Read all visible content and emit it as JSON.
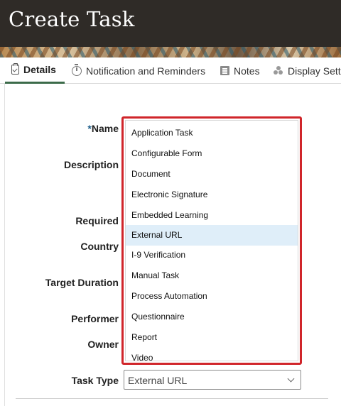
{
  "header": {
    "title": "Create Task"
  },
  "tabs": [
    {
      "label": "Details",
      "icon": "clipboard-check-icon"
    },
    {
      "label": "Notification and Reminders",
      "icon": "timer-icon"
    },
    {
      "label": "Notes",
      "icon": "note-icon"
    },
    {
      "label": "Display Sett",
      "icon": "display-settings-icon"
    }
  ],
  "form": {
    "required_marker": "*",
    "labels": {
      "name": "Name",
      "description": "Description",
      "required": "Required",
      "country": "Country",
      "target_duration": "Target Duration",
      "performer": "Performer",
      "owner": "Owner",
      "task_type": "Task Type"
    },
    "task_type_value": "External URL"
  },
  "dropdown": {
    "options": [
      "Application Task",
      "Configurable Form",
      "Document",
      "Electronic Signature",
      "Embedded Learning",
      "External URL",
      "I-9 Verification",
      "Manual Task",
      "Process Automation",
      "Questionnaire",
      "Report",
      "Video"
    ],
    "selected": "External URL",
    "highlight_color": "#d0252a",
    "selected_bg": "#dfeef9"
  }
}
